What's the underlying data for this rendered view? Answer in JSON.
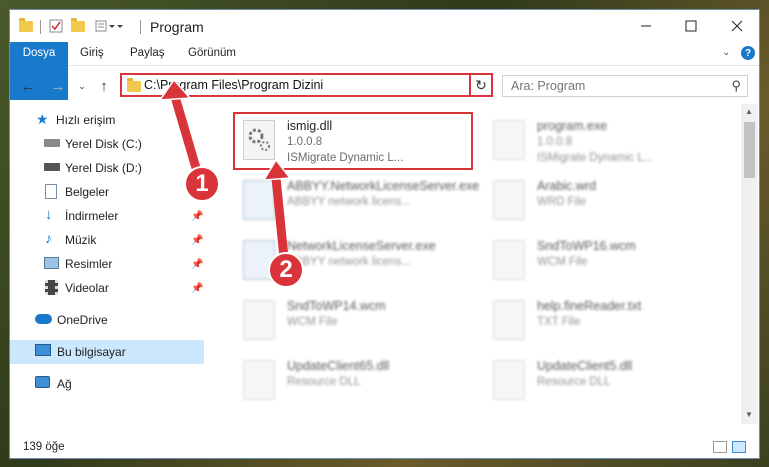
{
  "window": {
    "title": "Program",
    "controls": [
      "minimize-icon",
      "maximize-icon",
      "close-icon"
    ]
  },
  "ribbon": {
    "tabs": [
      {
        "label": "Dosya",
        "active": true
      },
      {
        "label": "Giriş"
      },
      {
        "label": "Paylaş"
      },
      {
        "label": "Görünüm"
      }
    ]
  },
  "navbar": {
    "address": "C:\\Program Files\\Program Dizini",
    "search_placeholder": "Ara: Program"
  },
  "sidebar": {
    "items": [
      {
        "label": "Hızlı erişim",
        "icon": "star-icon"
      },
      {
        "label": "Yerel Disk (C:)",
        "icon": "drive-icon"
      },
      {
        "label": "Yerel Disk (D:)",
        "icon": "drive-icon"
      },
      {
        "label": "Belgeler",
        "icon": "document-icon"
      },
      {
        "label": "İndirmeler",
        "icon": "download-icon",
        "pinned": true
      },
      {
        "label": "Müzik",
        "icon": "music-icon",
        "pinned": true
      },
      {
        "label": "Resimler",
        "icon": "picture-icon",
        "pinned": true
      },
      {
        "label": "Videolar",
        "icon": "video-icon",
        "pinned": true
      },
      {
        "label": "OneDrive",
        "icon": "cloud-icon"
      },
      {
        "label": "Bu bilgisayar",
        "icon": "computer-icon",
        "selected": true
      },
      {
        "label": "Ağ",
        "icon": "network-icon"
      }
    ]
  },
  "files": [
    {
      "name": "ismig.dll",
      "line2": "1.0.0.8",
      "line3": "ISMigrate Dynamic L...",
      "highlighted": true
    },
    {
      "name": "program.exe",
      "line2": "1.0.0.8",
      "line3": "ISMigrate Dynamic L..."
    },
    {
      "name": "ABBYY.NetworkLicenseServer.exe",
      "line2": "ABBYY network licens..."
    },
    {
      "name": "Arabic.wrd",
      "line2": "WRD File"
    },
    {
      "name": "NetworkLicenseServer.exe",
      "line2": "ABBYY network licens..."
    },
    {
      "name": "SndToWP16.wcm",
      "line2": "WCM File"
    },
    {
      "name": "SndToWP14.wcm",
      "line2": "WCM File"
    },
    {
      "name": "help.fineReader.txt",
      "line2": "TXT File"
    },
    {
      "name": "UpdateClient65.dll",
      "line2": "Resource DLL"
    },
    {
      "name": "UpdateClient5.dll",
      "line2": "Resource DLL"
    }
  ],
  "status": {
    "count": "139 öğe"
  },
  "annotations": {
    "callout1": "1",
    "callout2": "2",
    "accent_color": "#d9343a"
  }
}
